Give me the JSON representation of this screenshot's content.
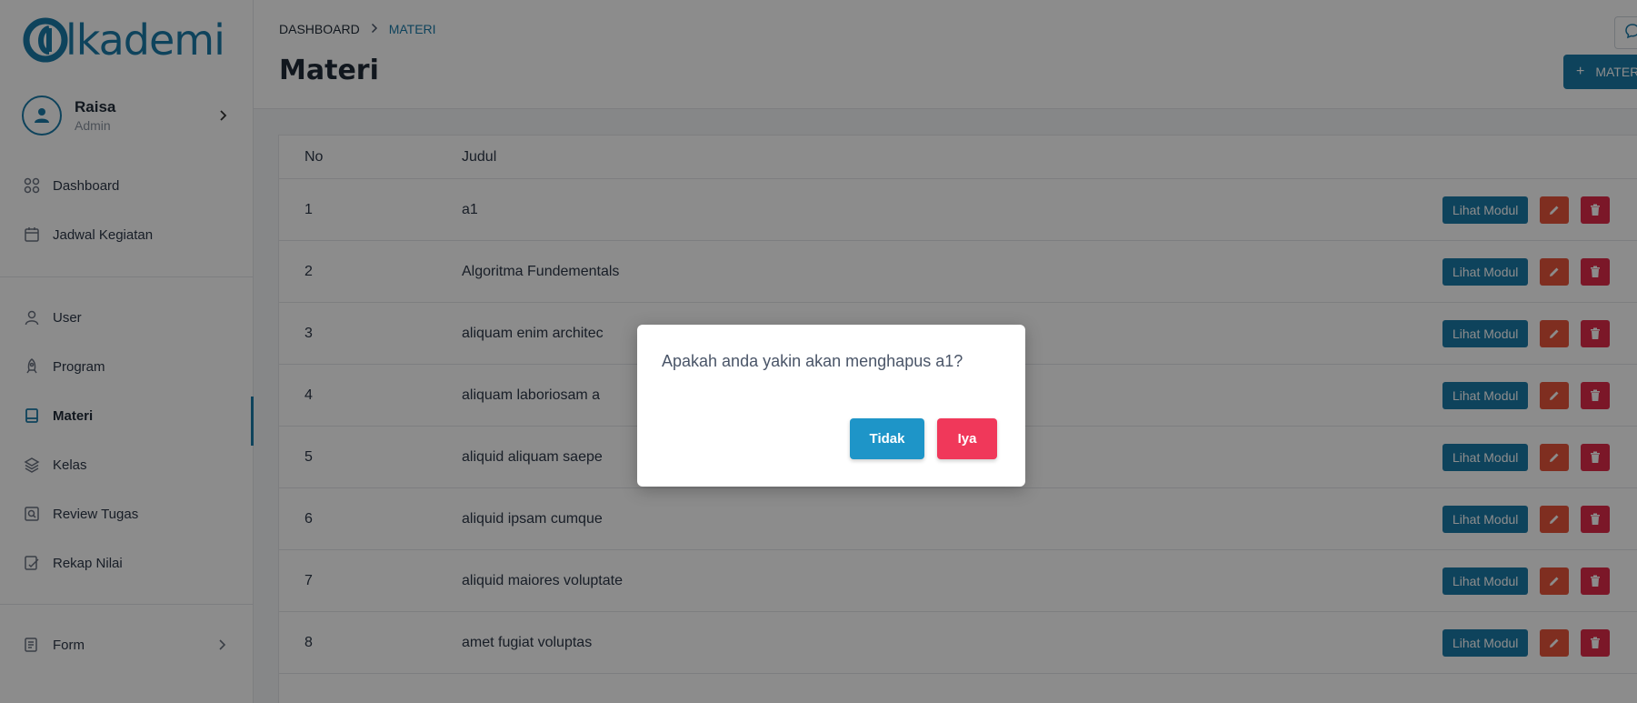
{
  "brand": {
    "name": "lkademi",
    "mark": "a",
    "color": "#1b7aa8"
  },
  "profile": {
    "name": "Raisa",
    "role": "Admin"
  },
  "sidebar": {
    "items": [
      {
        "label": "Dashboard",
        "icon": "grid-icon"
      },
      {
        "label": "Jadwal Kegiatan",
        "icon": "calendar-icon"
      },
      {
        "label": "User",
        "icon": "user-icon"
      },
      {
        "label": "Program",
        "icon": "rocket-icon"
      },
      {
        "label": "Materi",
        "icon": "book-icon",
        "active": true
      },
      {
        "label": "Kelas",
        "icon": "layers-icon"
      },
      {
        "label": "Review Tugas",
        "icon": "search-file-icon"
      },
      {
        "label": "Rekap Nilai",
        "icon": "edit-doc-icon"
      },
      {
        "label": "Form",
        "icon": "form-icon"
      }
    ]
  },
  "breadcrumb": {
    "home": "DASHBOARD",
    "current": "MATERI"
  },
  "page": {
    "title": "Materi",
    "add_label": "MATERI"
  },
  "table": {
    "headers": {
      "no": "No",
      "judul": "Judul"
    },
    "rows": [
      {
        "no": "1",
        "judul": "a1"
      },
      {
        "no": "2",
        "judul": "Algoritma Fundementals"
      },
      {
        "no": "3",
        "judul": "aliquam enim architec"
      },
      {
        "no": "4",
        "judul": "aliquam laboriosam a"
      },
      {
        "no": "5",
        "judul": "aliquid aliquam saepe"
      },
      {
        "no": "6",
        "judul": "aliquid ipsam cumque"
      },
      {
        "no": "7",
        "judul": "aliquid maiores voluptate"
      },
      {
        "no": "8",
        "judul": "amet fugiat voluptas"
      }
    ],
    "action_label": "Lihat Modul"
  },
  "modal": {
    "message": "Apakah anda yakin akan menghapus a1?",
    "cancel_label": "Tidak",
    "confirm_label": "Iya"
  },
  "colors": {
    "primary": "#1b7aa8",
    "edit": "#e8553b",
    "delete": "#e02a4a",
    "confirm": "#f0385a",
    "cancel": "#1e95c8"
  }
}
